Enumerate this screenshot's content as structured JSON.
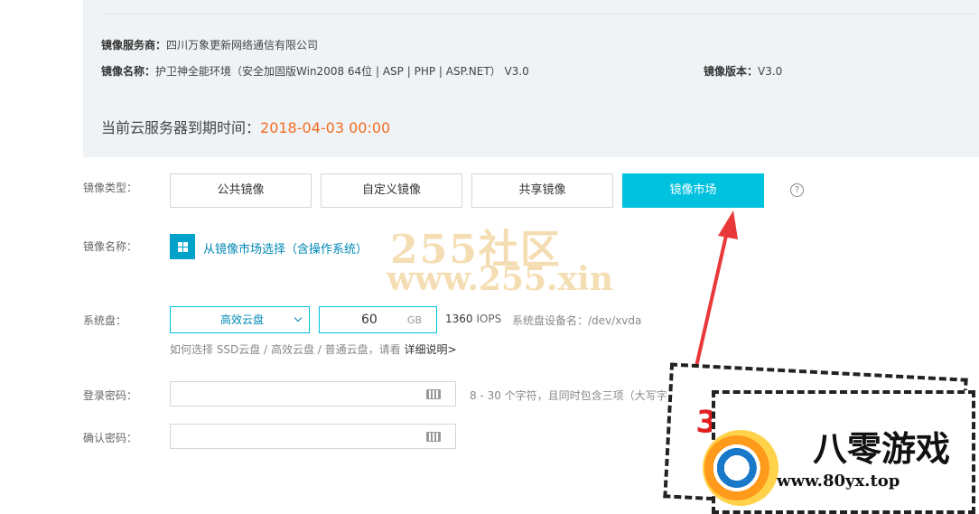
{
  "info": {
    "provider_label": "镜像服务商：",
    "provider_value": "四川万象更新网络通信有限公司",
    "name_label": "镜像名称：",
    "name_value": "护卫神全能环境（安全加固版Win2008 64位 | ASP | PHP | ASP.NET） V3.0",
    "version_label": "镜像版本：",
    "version_value": "V3.0",
    "expire_label": "当前云服务器到期时间：",
    "expire_value": "2018-04-03 00:00"
  },
  "image_type": {
    "label": "镜像类型：",
    "tabs": [
      {
        "label": "公共镜像",
        "active": false
      },
      {
        "label": "自定义镜像",
        "active": false
      },
      {
        "label": "共享镜像",
        "active": false
      },
      {
        "label": "镜像市场",
        "active": true
      }
    ],
    "help_icon": "?"
  },
  "image_name": {
    "label": "镜像名称：",
    "link": "从镜像市场选择（含操作系统）",
    "icon": "grid-icon"
  },
  "system_disk": {
    "label": "系统盘：",
    "type_value": "高效云盘",
    "size_value": "60",
    "size_unit": "GB",
    "iops_value": "1360",
    "iops_unit": "IOPS",
    "device": "系统盘设备名：/dev/xvda",
    "hint": "如何选择 SSD云盘 / 高效云盘 / 普通云盘，请看",
    "hint_link": "详细说明>"
  },
  "login_password": {
    "label": "登录密码：",
    "hint": "8 - 30 个字符，且同时包含三项（大写字"
  },
  "confirm_password": {
    "label": "确认密码："
  },
  "watermarks": {
    "site1_title": "255社区",
    "site1_url": "www.255.xin",
    "site2_brand": "八零游戏",
    "site2_url": "www.80yx.top",
    "site2_digit": "3"
  },
  "colors": {
    "accent": "#00c1de",
    "link": "#0088b5",
    "expire": "#f36c21",
    "arrow": "#e8383a",
    "panel_bg": "#eff3f6"
  }
}
